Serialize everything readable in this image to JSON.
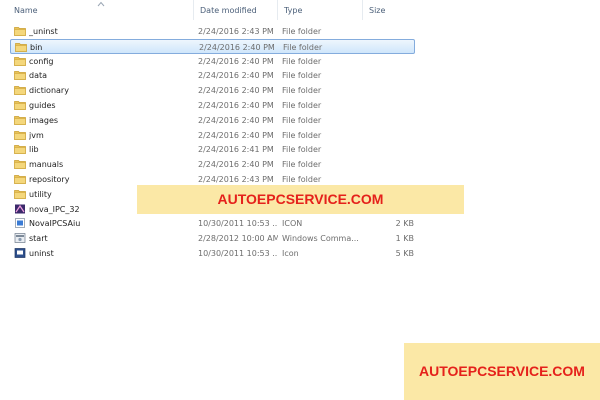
{
  "columns": {
    "name": "Name",
    "date_modified": "Date modified",
    "type": "Type",
    "size": "Size"
  },
  "files": [
    {
      "name": "_uninst",
      "date": "2/24/2016 2:43 PM",
      "type": "File folder",
      "size": "",
      "icon": "folder-icon"
    },
    {
      "name": "bin",
      "date": "2/24/2016 2:40 PM",
      "type": "File folder",
      "size": "",
      "icon": "folder-icon",
      "selected": true
    },
    {
      "name": "config",
      "date": "2/24/2016 2:40 PM",
      "type": "File folder",
      "size": "",
      "icon": "folder-icon"
    },
    {
      "name": "data",
      "date": "2/24/2016 2:40 PM",
      "type": "File folder",
      "size": "",
      "icon": "folder-icon"
    },
    {
      "name": "dictionary",
      "date": "2/24/2016 2:40 PM",
      "type": "File folder",
      "size": "",
      "icon": "folder-icon"
    },
    {
      "name": "guides",
      "date": "2/24/2016 2:40 PM",
      "type": "File folder",
      "size": "",
      "icon": "folder-icon"
    },
    {
      "name": "images",
      "date": "2/24/2016 2:40 PM",
      "type": "File folder",
      "size": "",
      "icon": "folder-icon"
    },
    {
      "name": "jvm",
      "date": "2/24/2016 2:40 PM",
      "type": "File folder",
      "size": "",
      "icon": "folder-icon"
    },
    {
      "name": "lib",
      "date": "2/24/2016 2:41 PM",
      "type": "File folder",
      "size": "",
      "icon": "folder-icon"
    },
    {
      "name": "manuals",
      "date": "2/24/2016 2:40 PM",
      "type": "File folder",
      "size": "",
      "icon": "folder-icon"
    },
    {
      "name": "repository",
      "date": "2/24/2016 2:43 PM",
      "type": "File folder",
      "size": "",
      "icon": "folder-icon"
    },
    {
      "name": "utility",
      "date": "",
      "type": "",
      "size": "",
      "icon": "folder-icon"
    },
    {
      "name": "nova_IPC_32",
      "date": "",
      "type": "",
      "size": "",
      "icon": "application-icon"
    },
    {
      "name": "NovaIPCSAiu",
      "date": "10/30/2011 10:53 ...",
      "type": "ICON",
      "size": "2 KB",
      "icon": "icon-file-icon"
    },
    {
      "name": "start",
      "date": "2/28/2012 10:00 AM",
      "type": "Windows Comma...",
      "size": "1 KB",
      "icon": "batch-file-icon"
    },
    {
      "name": "uninst",
      "date": "10/30/2011 10:53 ...",
      "type": "Icon",
      "size": "5 KB",
      "icon": "uninstall-icon"
    }
  ],
  "watermarks": [
    "AUTOEPCSERVICE.COM",
    "AUTOEPCSERVICE.COM"
  ],
  "colors": {
    "selection_border": "#84acdd",
    "watermark_bg": "#fbe8a6",
    "watermark_text": "#e5211b",
    "folder_yellow": "#e8c35a"
  }
}
